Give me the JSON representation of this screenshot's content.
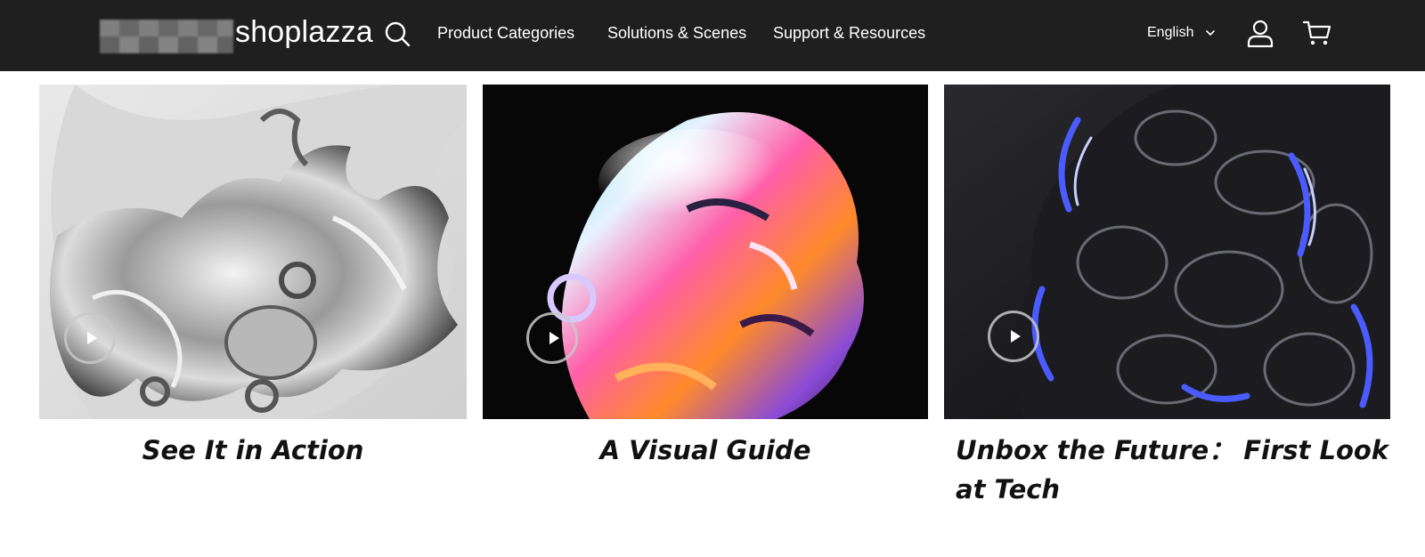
{
  "header": {
    "logo_text": "shoplazza",
    "nav": [
      "Product Categories",
      "Solutions & Scenes",
      "Support & Resources"
    ],
    "language": "English"
  },
  "cards": [
    {
      "title": "See It in Action"
    },
    {
      "title": "A Visual Guide"
    },
    {
      "title": "Unbox the Future： First Look at Tech"
    }
  ],
  "colors": {
    "header_bg": "#1f1f1f",
    "text_dark": "#111111",
    "text_light": "#ffffff"
  },
  "icons": [
    "search-icon",
    "chevron-down-icon",
    "user-icon",
    "cart-icon",
    "play-icon"
  ]
}
